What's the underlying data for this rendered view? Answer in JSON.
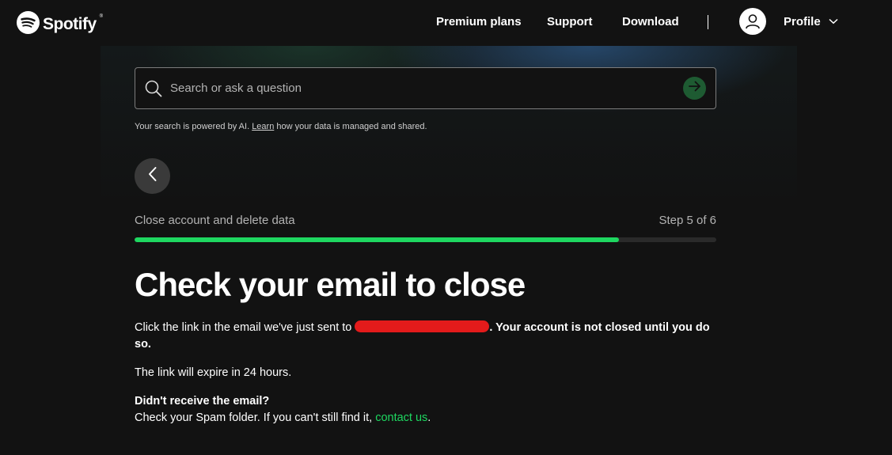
{
  "brand": {
    "name": "Spotify",
    "trademark": "®",
    "accent_color": "#1ed760"
  },
  "nav": {
    "links": [
      "Premium plans",
      "Support",
      "Download"
    ],
    "profile_label": "Profile"
  },
  "search": {
    "placeholder": "Search or ask a question",
    "value": "",
    "ai_note_prefix": "Your search is powered by AI. ",
    "ai_note_link": "Learn",
    "ai_note_suffix": " how your data is managed and shared."
  },
  "flow": {
    "title": "Close account and delete data",
    "step_text": "Step 5 of 6",
    "progress_fraction": 0.833
  },
  "content": {
    "heading": "Check your email to close",
    "p1_prefix": "Click the link in the email we've just sent to ",
    "p1_suffix_bold": ". Your account is not closed until you do so.",
    "p2": "The link will expire in 24 hours.",
    "p3_bold": "Didn't receive the email?",
    "p3_text": "Check your Spam folder. If you can't still find it, ",
    "p3_link": "contact us",
    "p3_end": "."
  },
  "icons": {
    "logo": "spotify-logo-icon",
    "avatar": "user-icon",
    "profile_menu": "chevron-down-icon",
    "search": "search-icon",
    "submit": "arrow-right-icon",
    "back": "chevron-left-icon"
  }
}
